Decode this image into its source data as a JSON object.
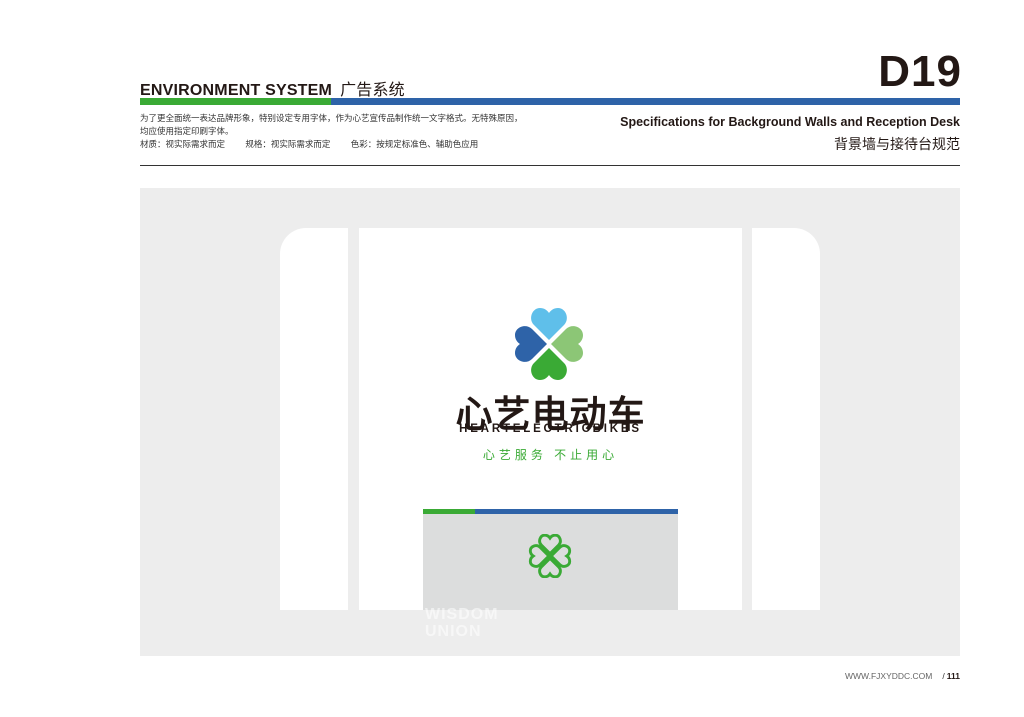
{
  "header": {
    "section_en": "ENVIRONMENT SYSTEM",
    "section_cn": "广告系统",
    "page_code": "D19",
    "colors": {
      "green": "#3aaa35",
      "blue": "#2e63a8"
    }
  },
  "description": {
    "line1": "为了更全面统一表达品牌形象，特别设定专用字体，作为心艺宣传品制作统一文字格式。无特殊原因，",
    "line2": "均应使用指定印刷字体。",
    "material": "材质：视实际需求而定",
    "size": "规格：视实际需求而定",
    "color": "色彩：按规定标准色、辅助色应用"
  },
  "spec": {
    "title_en": "Specifications for Background Walls and Reception Desk",
    "title_cn": "背景墙与接待台规范"
  },
  "illustration": {
    "brand_cn": "心艺电动车",
    "brand_en": "HEARTELECTRICBIKES",
    "slogan": "心艺服务 不止用心",
    "logo_icon": "four-heart-clover-logo-icon",
    "desk_icon": "clover-outline-icon",
    "watermark_line1": "WISDOM",
    "watermark_line2": "UNION"
  },
  "footer": {
    "url": "WWW.FJXYDDC.COM",
    "page_number": "111"
  }
}
